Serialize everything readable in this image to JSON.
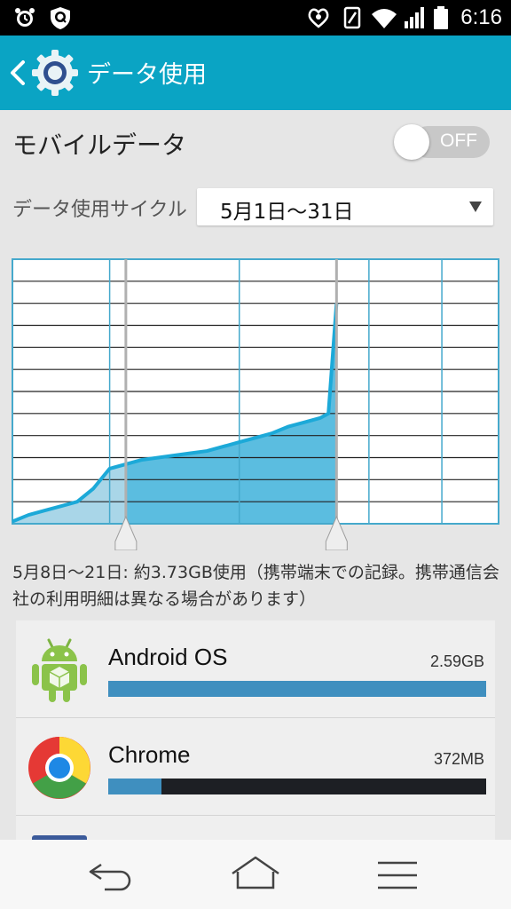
{
  "status_bar": {
    "time": "6:16",
    "icons": [
      "alarm-clock-icon",
      "shield-app-icon",
      "heart-nfc-icon",
      "vibrate-icon",
      "wifi-icon",
      "signal-icon",
      "battery-icon"
    ]
  },
  "app_bar": {
    "title": "データ使用",
    "color": "#0aa4c4",
    "icons": [
      "back-icon",
      "gear-icon"
    ]
  },
  "mobile_data": {
    "label": "モバイルデータ",
    "toggle_state": "OFF"
  },
  "cycle": {
    "label": "データ使用サイクル",
    "value": "5月1日〜31日"
  },
  "chart_data": {
    "type": "area",
    "title": "",
    "xlabel": "",
    "ylabel": "",
    "x_range": [
      1,
      31
    ],
    "y_range": [
      0,
      12
    ],
    "grid": true,
    "selected_range": [
      8,
      21
    ],
    "x": [
      1,
      2,
      3,
      4,
      5,
      6,
      7,
      8,
      9,
      10,
      11,
      12,
      13,
      14,
      15,
      16,
      17,
      18,
      19,
      20,
      20.5,
      21
    ],
    "values": [
      0.1,
      0.4,
      0.6,
      0.8,
      1.0,
      1.6,
      2.5,
      2.7,
      2.9,
      3.0,
      3.1,
      3.2,
      3.3,
      3.5,
      3.7,
      3.9,
      4.1,
      4.4,
      4.6,
      4.8,
      5.0,
      10.0
    ],
    "colors": {
      "fill": "#5bbde0",
      "fill_faded": "#a9d6e8",
      "line": "#1ca9d8",
      "grid": "#222222",
      "vgrid": "#45a9cc"
    }
  },
  "usage_summary": "5月8日〜21日: 約3.73GB使用（携帯端末での記録。携帯通信会社の利用明細は異なる場合があります）",
  "apps": [
    {
      "name": "Android OS",
      "size": "2.59GB",
      "fraction": 1.0,
      "icon": "android-icon"
    },
    {
      "name": "Chrome",
      "size": "372MB",
      "fraction": 0.14,
      "icon": "chrome-icon"
    }
  ],
  "nav_bar": {
    "icons": [
      "back-arrow-icon",
      "home-icon",
      "menu-icon"
    ]
  }
}
